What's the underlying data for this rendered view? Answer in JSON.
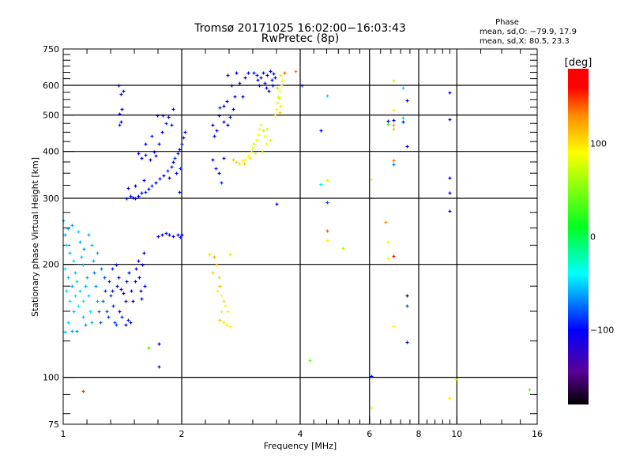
{
  "chart_data": {
    "type": "scatter",
    "title": "Tromsø 20171025 16:02:00−16:03:43",
    "subtitle": "RwPretec (8p)",
    "stats": {
      "heading": "Phase",
      "line_o": "mean, sd,O: −79.9, 17.9",
      "line_x": "mean, sd,X:  80.5, 23.3"
    },
    "xlabel": "Frequency [MHz]",
    "ylabel": "Stationary phase Virtual Height [km]",
    "xscale": "log",
    "yscale": "log",
    "xlim": [
      1,
      16
    ],
    "ylim": [
      75,
      750
    ],
    "xticks": [
      {
        "v": 1,
        "label": "1"
      },
      {
        "v": 2,
        "label": "2"
      },
      {
        "v": 4,
        "label": "4"
      },
      {
        "v": 6,
        "label": "6"
      },
      {
        "v": 8,
        "label": "8"
      },
      {
        "v": 10,
        "label": "10"
      },
      {
        "v": 16,
        "label": "16"
      }
    ],
    "yticks": [
      {
        "v": 75,
        "label": "75"
      },
      {
        "v": 100,
        "label": "100"
      },
      {
        "v": 200,
        "label": "200"
      },
      {
        "v": 300,
        "label": "300"
      },
      {
        "v": 400,
        "label": "400"
      },
      {
        "v": 500,
        "label": "500"
      },
      {
        "v": 600,
        "label": "600"
      },
      {
        "v": 750,
        "label": "750"
      }
    ],
    "xgrid": [
      2,
      4,
      6,
      8,
      10
    ],
    "ygrid": [
      100,
      200,
      300,
      400,
      500,
      600
    ],
    "colorbar": {
      "label": "[deg]",
      "range": [
        -180,
        180
      ],
      "ticks": [
        {
          "v": 100,
          "label": "100"
        },
        {
          "v": 0,
          "label": "0"
        },
        {
          "v": -100,
          "label": "−100"
        }
      ],
      "stops": [
        [
          -180,
          "#000000"
        ],
        [
          -145,
          "#5a0096"
        ],
        [
          -100,
          "#0000ff"
        ],
        [
          -40,
          "#00ffff"
        ],
        [
          10,
          "#00ff20"
        ],
        [
          90,
          "#ffff00"
        ],
        [
          130,
          "#ff8c00"
        ],
        [
          160,
          "#ff0000"
        ],
        [
          180,
          "#ff0000"
        ]
      ]
    },
    "points_fields": [
      "freq_MHz",
      "height_km",
      "phase_deg"
    ],
    "points": [
      [
        1.0,
        262,
        -55
      ],
      [
        1.01,
        240,
        -60
      ],
      [
        1.02,
        225,
        -50
      ],
      [
        1.03,
        250,
        -65
      ],
      [
        1.05,
        255,
        -60
      ],
      [
        1.04,
        215,
        -55
      ],
      [
        1.06,
        205,
        -50
      ],
      [
        1.01,
        195,
        -45
      ],
      [
        1.03,
        185,
        -55
      ],
      [
        1.02,
        170,
        -50
      ],
      [
        1.05,
        175,
        -60
      ],
      [
        1.07,
        190,
        -55
      ],
      [
        1.08,
        180,
        -50
      ],
      [
        1.04,
        160,
        -45
      ],
      [
        1.06,
        150,
        -55
      ],
      [
        1.03,
        140,
        -50
      ],
      [
        1.01,
        132,
        -55
      ],
      [
        1.05,
        133,
        -60
      ],
      [
        1.08,
        133,
        -65
      ],
      [
        1.1,
        230,
        -60
      ],
      [
        1.11,
        210,
        -55
      ],
      [
        1.12,
        200,
        -50
      ],
      [
        1.13,
        220,
        -65
      ],
      [
        1.1,
        170,
        -50
      ],
      [
        1.12,
        160,
        -45
      ],
      [
        1.14,
        175,
        -55
      ],
      [
        1.15,
        185,
        -60
      ],
      [
        1.16,
        165,
        -50
      ],
      [
        1.17,
        150,
        -45
      ],
      [
        1.18,
        140,
        -60
      ],
      [
        1.14,
        138,
        -65
      ],
      [
        1.12,
        145,
        -55
      ],
      [
        1.09,
        155,
        -40
      ],
      [
        1.07,
        165,
        -45
      ],
      [
        1.19,
        205,
        -60
      ],
      [
        1.2,
        190,
        -70
      ],
      [
        1.21,
        175,
        -65
      ],
      [
        1.22,
        160,
        -60
      ],
      [
        1.23,
        150,
        -75
      ],
      [
        1.24,
        140,
        -80
      ],
      [
        1.25,
        195,
        -70
      ],
      [
        1.27,
        185,
        -80
      ],
      [
        1.28,
        170,
        -85
      ],
      [
        1.26,
        160,
        -75
      ],
      [
        1.29,
        150,
        -80
      ],
      [
        1.3,
        145,
        -85
      ],
      [
        1.31,
        180,
        -90
      ],
      [
        1.32,
        165,
        -85
      ],
      [
        1.33,
        170,
        -95
      ],
      [
        1.34,
        155,
        -90
      ],
      [
        1.35,
        140,
        -85
      ],
      [
        1.36,
        138,
        -80
      ],
      [
        1.37,
        175,
        -95
      ],
      [
        1.38,
        185,
        -100
      ],
      [
        1.4,
        172,
        -105
      ],
      [
        1.42,
        168,
        -100
      ],
      [
        1.44,
        160,
        -105
      ],
      [
        1.45,
        180,
        -95
      ],
      [
        1.47,
        190,
        -100
      ],
      [
        1.49,
        170,
        -110
      ],
      [
        1.5,
        160,
        -100
      ],
      [
        1.52,
        180,
        -105
      ],
      [
        1.53,
        195,
        -100
      ],
      [
        1.55,
        205,
        -105
      ],
      [
        1.56,
        185,
        -100
      ],
      [
        1.57,
        170,
        -110
      ],
      [
        1.58,
        162,
        -95
      ],
      [
        1.59,
        200,
        -105
      ],
      [
        1.6,
        215,
        -100
      ],
      [
        1.61,
        175,
        -100
      ],
      [
        1.44,
        138,
        -100
      ],
      [
        1.46,
        142,
        -95
      ],
      [
        1.48,
        140,
        -100
      ],
      [
        1.39,
        150,
        -100
      ],
      [
        1.41,
        145,
        -90
      ],
      [
        1.18,
        225,
        -55
      ],
      [
        1.16,
        240,
        -60
      ],
      [
        1.09,
        245,
        -50
      ],
      [
        1.22,
        215,
        -60
      ],
      [
        1.33,
        195,
        -90
      ],
      [
        1.36,
        200,
        -95
      ],
      [
        1.45,
        300,
        -100
      ],
      [
        1.48,
        305,
        -95
      ],
      [
        1.5,
        302,
        -100
      ],
      [
        1.52,
        300,
        -105
      ],
      [
        1.55,
        305,
        -100
      ],
      [
        1.58,
        310,
        -100
      ],
      [
        1.62,
        312,
        -95
      ],
      [
        1.65,
        318,
        -100
      ],
      [
        1.68,
        325,
        -90
      ],
      [
        1.72,
        330,
        -100
      ],
      [
        1.76,
        338,
        -95
      ],
      [
        1.8,
        345,
        -100
      ],
      [
        1.84,
        355,
        -90
      ],
      [
        1.88,
        365,
        -95
      ],
      [
        1.9,
        375,
        -100
      ],
      [
        1.92,
        385,
        -90
      ],
      [
        1.95,
        395,
        -95
      ],
      [
        1.97,
        405,
        -100
      ],
      [
        2.0,
        420,
        -90
      ],
      [
        2.02,
        435,
        -95
      ],
      [
        2.04,
        450,
        -100
      ],
      [
        1.98,
        360,
        -90
      ],
      [
        1.94,
        350,
        -100
      ],
      [
        1.86,
        340,
        -110
      ],
      [
        1.46,
        320,
        -110
      ],
      [
        1.52,
        325,
        -100
      ],
      [
        1.55,
        395,
        -110
      ],
      [
        1.58,
        385,
        -100
      ],
      [
        1.62,
        392,
        -95
      ],
      [
        1.66,
        380,
        -110
      ],
      [
        1.7,
        400,
        -100
      ],
      [
        1.75,
        420,
        -95
      ],
      [
        1.78,
        450,
        -100
      ],
      [
        1.82,
        475,
        -90
      ],
      [
        1.85,
        495,
        -100
      ],
      [
        1.88,
        470,
        -95
      ],
      [
        1.72,
        390,
        -120
      ],
      [
        1.62,
        420,
        -100
      ],
      [
        1.68,
        440,
        -90
      ],
      [
        1.73,
        500,
        -100
      ],
      [
        1.79,
        500,
        -95
      ],
      [
        1.9,
        520,
        -100
      ],
      [
        1.78,
        240,
        -100
      ],
      [
        1.82,
        242,
        -95
      ],
      [
        1.86,
        240,
        -100
      ],
      [
        1.9,
        238,
        -105
      ],
      [
        1.95,
        240,
        -100
      ],
      [
        1.98,
        237,
        -95
      ],
      [
        2.0,
        240,
        -100
      ],
      [
        1.74,
        238,
        -110
      ],
      [
        1.38,
        600,
        -100
      ],
      [
        1.4,
        570,
        -95
      ],
      [
        1.42,
        580,
        -105
      ],
      [
        1.41,
        520,
        -100
      ],
      [
        1.39,
        505,
        -100
      ],
      [
        1.39,
        470,
        -90
      ],
      [
        1.4,
        480,
        -100
      ],
      [
        2.4,
        470,
        -100
      ],
      [
        2.42,
        440,
        -95
      ],
      [
        2.45,
        455,
        -110
      ],
      [
        2.48,
        500,
        -100
      ],
      [
        2.5,
        525,
        -95
      ],
      [
        2.55,
        530,
        -100
      ],
      [
        2.6,
        545,
        -110
      ],
      [
        2.55,
        480,
        -105
      ],
      [
        2.62,
        470,
        -100
      ],
      [
        2.65,
        495,
        -95
      ],
      [
        2.7,
        520,
        -100
      ],
      [
        2.72,
        560,
        -110
      ],
      [
        2.68,
        600,
        -100
      ],
      [
        2.62,
        640,
        -105
      ],
      [
        2.75,
        650,
        -100
      ],
      [
        2.8,
        610,
        -95
      ],
      [
        2.85,
        560,
        -100
      ],
      [
        2.9,
        630,
        -105
      ],
      [
        2.95,
        650,
        -100
      ],
      [
        2.4,
        380,
        -100
      ],
      [
        2.44,
        360,
        -95
      ],
      [
        2.48,
        350,
        -100
      ],
      [
        2.52,
        330,
        -90
      ],
      [
        2.55,
        385,
        -120
      ],
      [
        3.05,
        650,
        -100
      ],
      [
        3.1,
        640,
        -95
      ],
      [
        3.12,
        620,
        -105
      ],
      [
        3.15,
        600,
        -100
      ],
      [
        3.18,
        630,
        -110
      ],
      [
        3.22,
        650,
        -100
      ],
      [
        3.25,
        610,
        -95
      ],
      [
        3.28,
        590,
        -100
      ],
      [
        3.3,
        640,
        -105
      ],
      [
        3.35,
        655,
        -100
      ],
      [
        3.38,
        620,
        -95
      ],
      [
        3.4,
        600,
        -100
      ],
      [
        3.42,
        645,
        -110
      ],
      [
        3.45,
        630,
        -100
      ],
      [
        3.32,
        580,
        -100
      ],
      [
        2.7,
        380,
        110
      ],
      [
        2.75,
        375,
        105
      ],
      [
        2.8,
        372,
        100
      ],
      [
        2.85,
        378,
        95
      ],
      [
        2.9,
        380,
        90
      ],
      [
        2.95,
        390,
        85
      ],
      [
        3.0,
        400,
        80
      ],
      [
        3.02,
        410,
        85
      ],
      [
        3.05,
        420,
        75
      ],
      [
        3.1,
        430,
        80
      ],
      [
        3.12,
        445,
        90
      ],
      [
        3.15,
        460,
        85
      ],
      [
        3.18,
        470,
        80
      ],
      [
        3.22,
        455,
        75
      ],
      [
        3.25,
        440,
        90
      ],
      [
        3.28,
        420,
        95
      ],
      [
        3.2,
        400,
        70
      ],
      [
        3.08,
        395,
        85
      ],
      [
        2.98,
        385,
        100
      ],
      [
        2.88,
        372,
        110
      ],
      [
        3.3,
        460,
        80
      ],
      [
        3.35,
        430,
        100
      ],
      [
        3.45,
        500,
        90
      ],
      [
        3.48,
        520,
        85
      ],
      [
        3.5,
        540,
        80
      ],
      [
        3.52,
        560,
        75
      ],
      [
        3.55,
        580,
        85
      ],
      [
        3.58,
        600,
        90
      ],
      [
        3.6,
        620,
        80
      ],
      [
        3.56,
        640,
        100
      ],
      [
        3.53,
        555,
        70
      ],
      [
        3.57,
        530,
        95
      ],
      [
        3.5,
        590,
        60
      ],
      [
        3.54,
        510,
        110
      ],
      [
        3.65,
        650,
        140
      ],
      [
        2.4,
        190,
        110
      ],
      [
        2.45,
        200,
        100
      ],
      [
        2.42,
        210,
        120
      ],
      [
        2.48,
        185,
        105
      ],
      [
        2.5,
        175,
        115
      ],
      [
        2.46,
        170,
        95
      ],
      [
        2.52,
        165,
        90
      ],
      [
        2.55,
        160,
        100
      ],
      [
        2.58,
        155,
        85
      ],
      [
        2.62,
        150,
        95
      ],
      [
        2.5,
        142,
        110
      ],
      [
        2.55,
        140,
        100
      ],
      [
        2.6,
        138,
        95
      ],
      [
        2.65,
        137,
        90
      ],
      [
        2.52,
        150,
        80
      ],
      [
        2.35,
        213,
        70
      ],
      [
        2.65,
        213,
        70
      ],
      [
        1.65,
        120,
        20
      ],
      [
        1.75,
        123,
        -100
      ],
      [
        1.75,
        107,
        -140
      ],
      [
        1.12,
        92,
        150
      ],
      [
        1.97,
        312,
        -100
      ],
      [
        1.6,
        335,
        -110
      ],
      [
        3.48,
        290,
        -100
      ],
      [
        3.89,
        655,
        130
      ],
      [
        4.04,
        599,
        -95
      ],
      [
        4.67,
        564,
        -50
      ],
      [
        4.51,
        455,
        -100
      ],
      [
        4.51,
        328,
        -45
      ],
      [
        4.67,
        335,
        75
      ],
      [
        4.67,
        293,
        -85
      ],
      [
        4.67,
        246,
        140
      ],
      [
        4.67,
        232,
        95
      ],
      [
        5.13,
        221,
        60
      ],
      [
        4.23,
        111,
        40
      ],
      [
        6.06,
        101,
        -100
      ],
      [
        6.06,
        83,
        80
      ],
      [
        6.9,
        618,
        70
      ],
      [
        7.29,
        592,
        -50
      ],
      [
        7.45,
        546,
        -100
      ],
      [
        6.9,
        516,
        95
      ],
      [
        6.68,
        483,
        -100
      ],
      [
        6.9,
        486,
        -105
      ],
      [
        7.29,
        493,
        -50
      ],
      [
        7.29,
        481,
        -95
      ],
      [
        6.68,
        474,
        30
      ],
      [
        6.9,
        470,
        125
      ],
      [
        6.9,
        460,
        110
      ],
      [
        7.45,
        414,
        -105
      ],
      [
        6.9,
        378,
        135
      ],
      [
        6.9,
        369,
        -70
      ],
      [
        6.06,
        337,
        90
      ],
      [
        6.58,
        260,
        130
      ],
      [
        6.68,
        230,
        95
      ],
      [
        6.9,
        211,
        165
      ],
      [
        6.68,
        208,
        85
      ],
      [
        7.45,
        165,
        -100
      ],
      [
        7.45,
        155,
        -80
      ],
      [
        6.9,
        137,
        95
      ],
      [
        7.45,
        124,
        -95
      ],
      [
        9.6,
        575,
        -100
      ],
      [
        9.6,
        488,
        -100
      ],
      [
        9.6,
        340,
        -100
      ],
      [
        9.6,
        310,
        -100
      ],
      [
        9.6,
        277,
        -100
      ],
      [
        9.95,
        99,
        70
      ],
      [
        9.6,
        88,
        95
      ],
      [
        15.3,
        93,
        40
      ]
    ]
  }
}
